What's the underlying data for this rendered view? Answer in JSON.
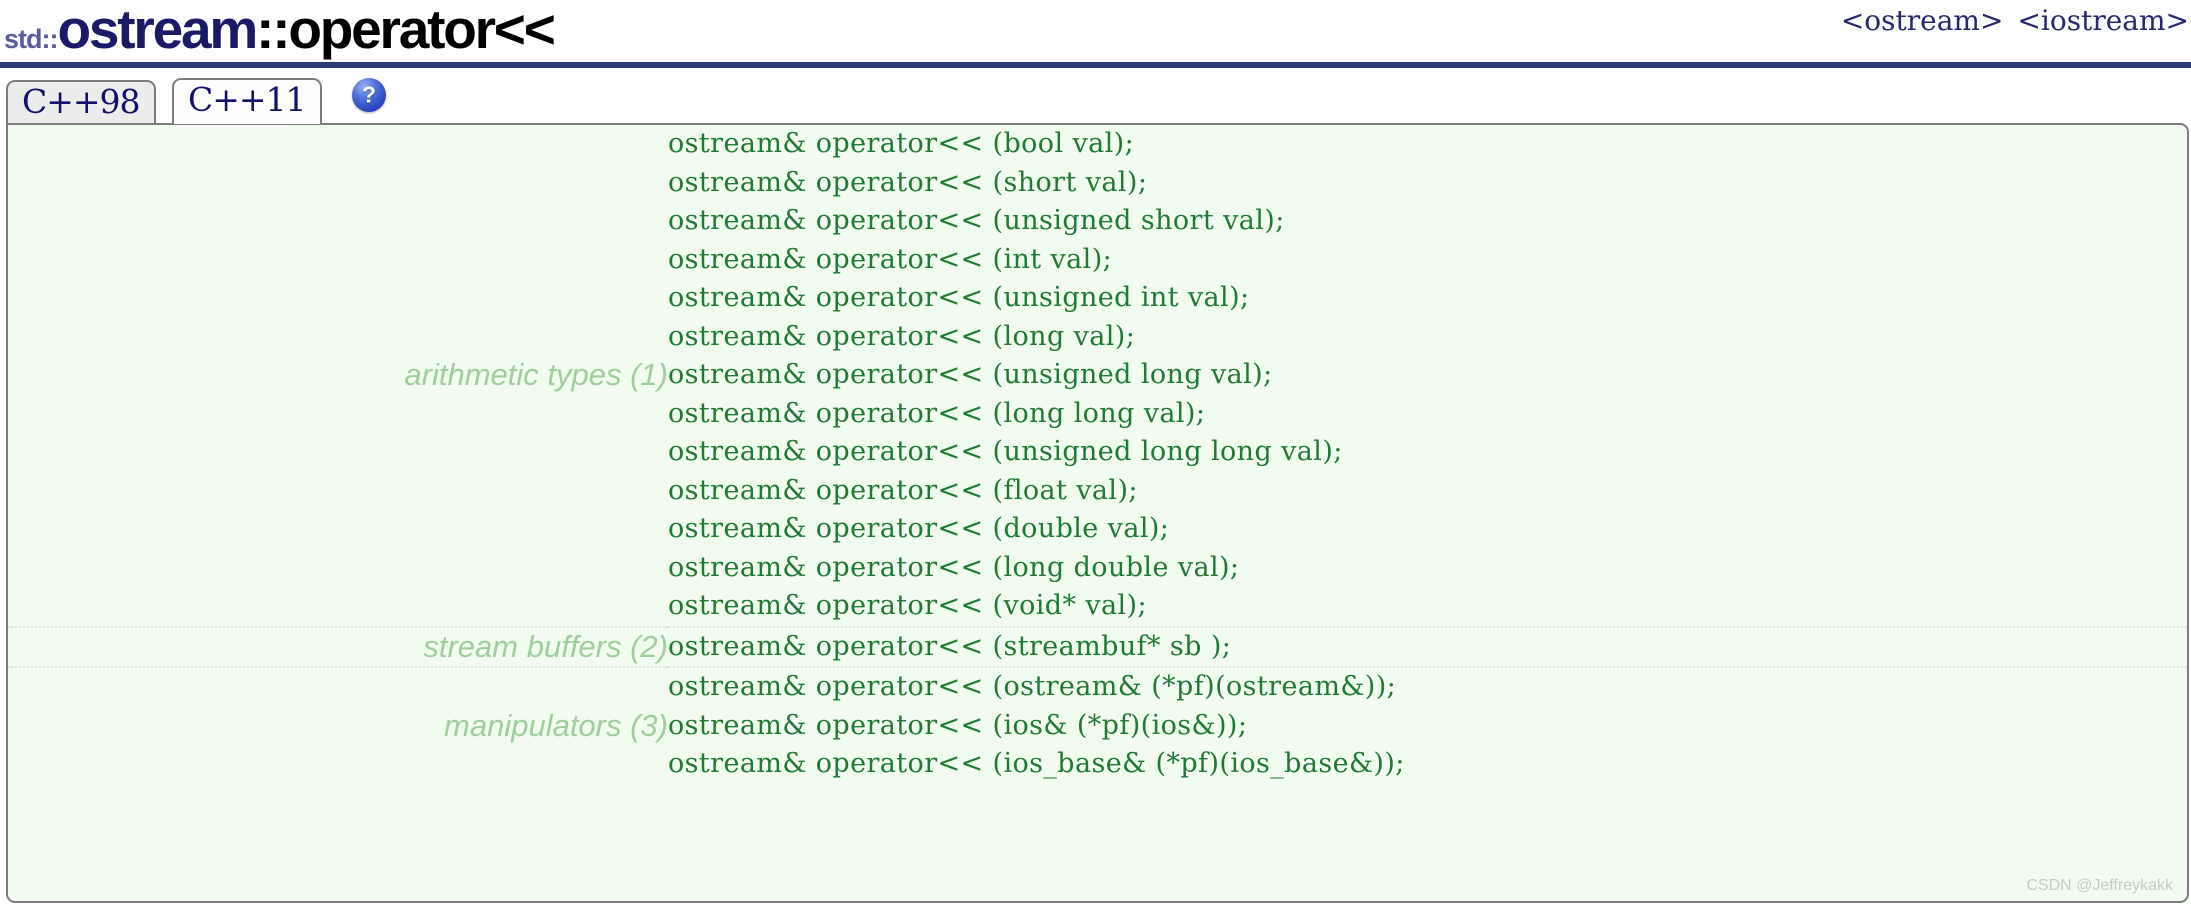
{
  "header": {
    "title_namespace": "std::",
    "title_class": "ostream",
    "title_separator": "::",
    "title_member": "operator<<",
    "links": [
      {
        "label": "<ostream>",
        "name": "header-link-ostream"
      },
      {
        "label": "<iostream>",
        "name": "header-link-iostream"
      }
    ],
    "rule_color": "#2b3a72"
  },
  "tabs": [
    {
      "label": "C++98",
      "active": false
    },
    {
      "label": "C++11",
      "active": true
    }
  ],
  "help_icon": {
    "glyph": "?",
    "name": "help-icon",
    "color": "#2a46c0"
  },
  "colors": {
    "panel_background": "#f1fbf0",
    "panel_border": "#7d7d7d",
    "code_text": "#1f7a33",
    "group_label": "#9fcd9c",
    "tab_text": "#11116b",
    "tab_inactive_background": "#ececec",
    "tab_active_background": "#fdfdfd",
    "row_separator": "#d8e6d7",
    "title_namespace": "#5b5ba0",
    "title_class": "#1a1a66",
    "title_member": "#000000"
  },
  "overload_groups": [
    {
      "label": "arithmetic types (1)",
      "signatures": [
        "ostream& operator<< (bool val);",
        "ostream& operator<< (short val);",
        "ostream& operator<< (unsigned short val);",
        "ostream& operator<< (int val);",
        "ostream& operator<< (unsigned int val);",
        "ostream& operator<< (long val);",
        "ostream& operator<< (unsigned long val);",
        "ostream& operator<< (long long val);",
        "ostream& operator<< (unsigned long long val);",
        "ostream& operator<< (float val);",
        "ostream& operator<< (double val);",
        "ostream& operator<< (long double val);",
        "ostream& operator<< (void* val);"
      ]
    },
    {
      "label": "stream buffers (2)",
      "signatures": [
        "ostream& operator<< (streambuf* sb );"
      ]
    },
    {
      "label": "manipulators (3)",
      "signatures": [
        "ostream& operator<< (ostream& (*pf)(ostream&));",
        "ostream& operator<< (ios& (*pf)(ios&));",
        "ostream& operator<< (ios_base& (*pf)(ios_base&));"
      ]
    }
  ],
  "watermark": "CSDN @Jeffreykakk"
}
